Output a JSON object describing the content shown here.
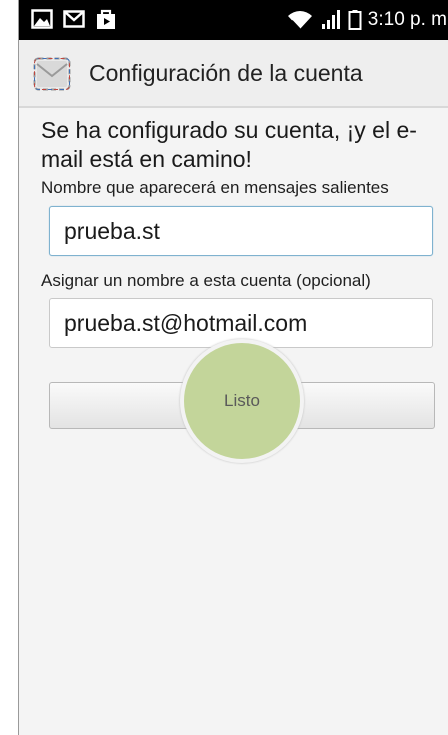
{
  "status_bar": {
    "time": "3:10 p. m",
    "icons": [
      "gallery-icon",
      "gmail-icon",
      "shopping-bag-icon",
      "wifi-icon",
      "signal-icon",
      "battery-icon"
    ]
  },
  "action_bar": {
    "title": "Configuración de la cuenta",
    "icon": "mail-envelope-icon"
  },
  "content": {
    "headline": "Se ha configurado su cuenta, ¡y el e-mail está en camino!",
    "sender_name_label": "Nombre que aparecerá en mensajes salientes",
    "sender_name_value": "prueba.st",
    "account_name_label": "Asignar un nombre a esta cuenta (opcional)",
    "account_name_value": "prueba.st@hotmail.com",
    "done_button": "Listo"
  },
  "colors": {
    "status_bar": "#000000",
    "touch_highlight": "#c3d59a",
    "focused_border": "#7fb2cf"
  }
}
